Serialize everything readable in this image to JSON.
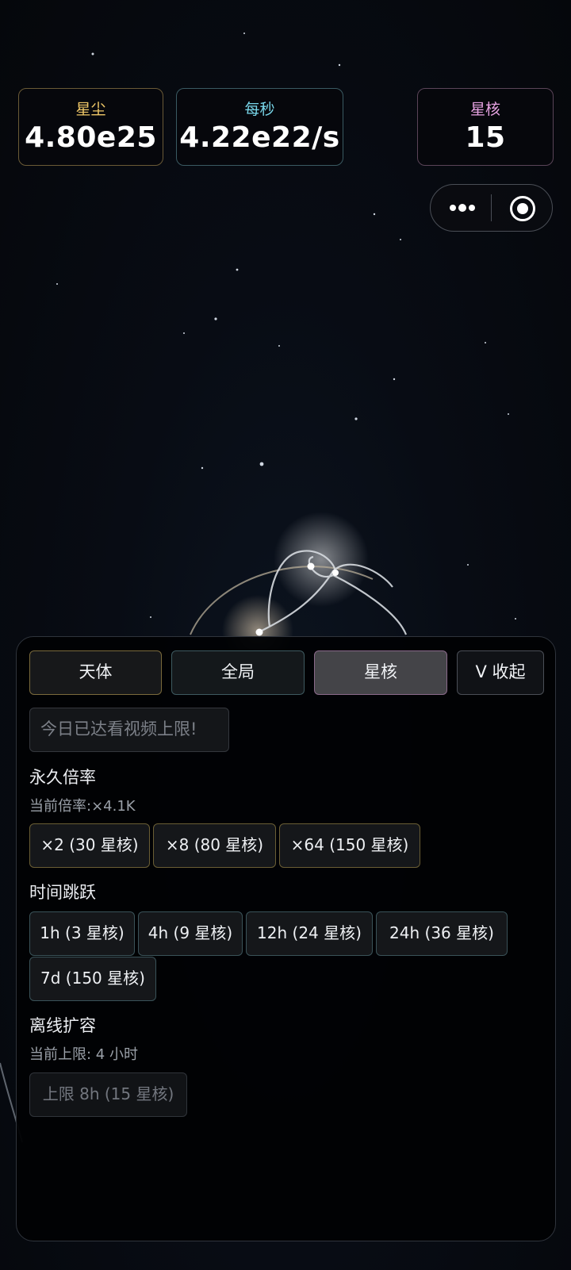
{
  "stats": {
    "stardust_label": "星尘",
    "stardust_value": "4.80e25",
    "per_second_label": "每秒",
    "per_second_value": "4.22e22/s",
    "core_label": "星核",
    "core_value": "15"
  },
  "capsule": {
    "more_icon": "more-dots-icon",
    "target_icon": "target-icon"
  },
  "tabs": [
    {
      "label": "天体"
    },
    {
      "label": "全局"
    },
    {
      "label": "星核",
      "active": true
    },
    {
      "label": "V 收起"
    }
  ],
  "notice": "今日已达看视频上限!",
  "multiplier": {
    "title": "永久倍率",
    "current": "当前倍率:×4.1K",
    "buttons": [
      "×2 (30 星核)",
      "×8 (80 星核)",
      "×64 (150 星核)"
    ]
  },
  "time_jump": {
    "title": "时间跳跃",
    "buttons": [
      "1h (3 星核)",
      "4h (9 星核)",
      "12h (24 星核)",
      "24h (36 星核)",
      "7d (150 星核)"
    ]
  },
  "offline": {
    "title": "离线扩容",
    "current": "当前上限: 4 小时",
    "button": "上限 8h (15 星核)"
  },
  "colors": {
    "stardust_accent": "#f0c868",
    "per_second_accent": "#78d6ea",
    "core_accent": "#e6a2e2",
    "gold_border": "#6a5e34",
    "teal_border": "#3a5258"
  }
}
